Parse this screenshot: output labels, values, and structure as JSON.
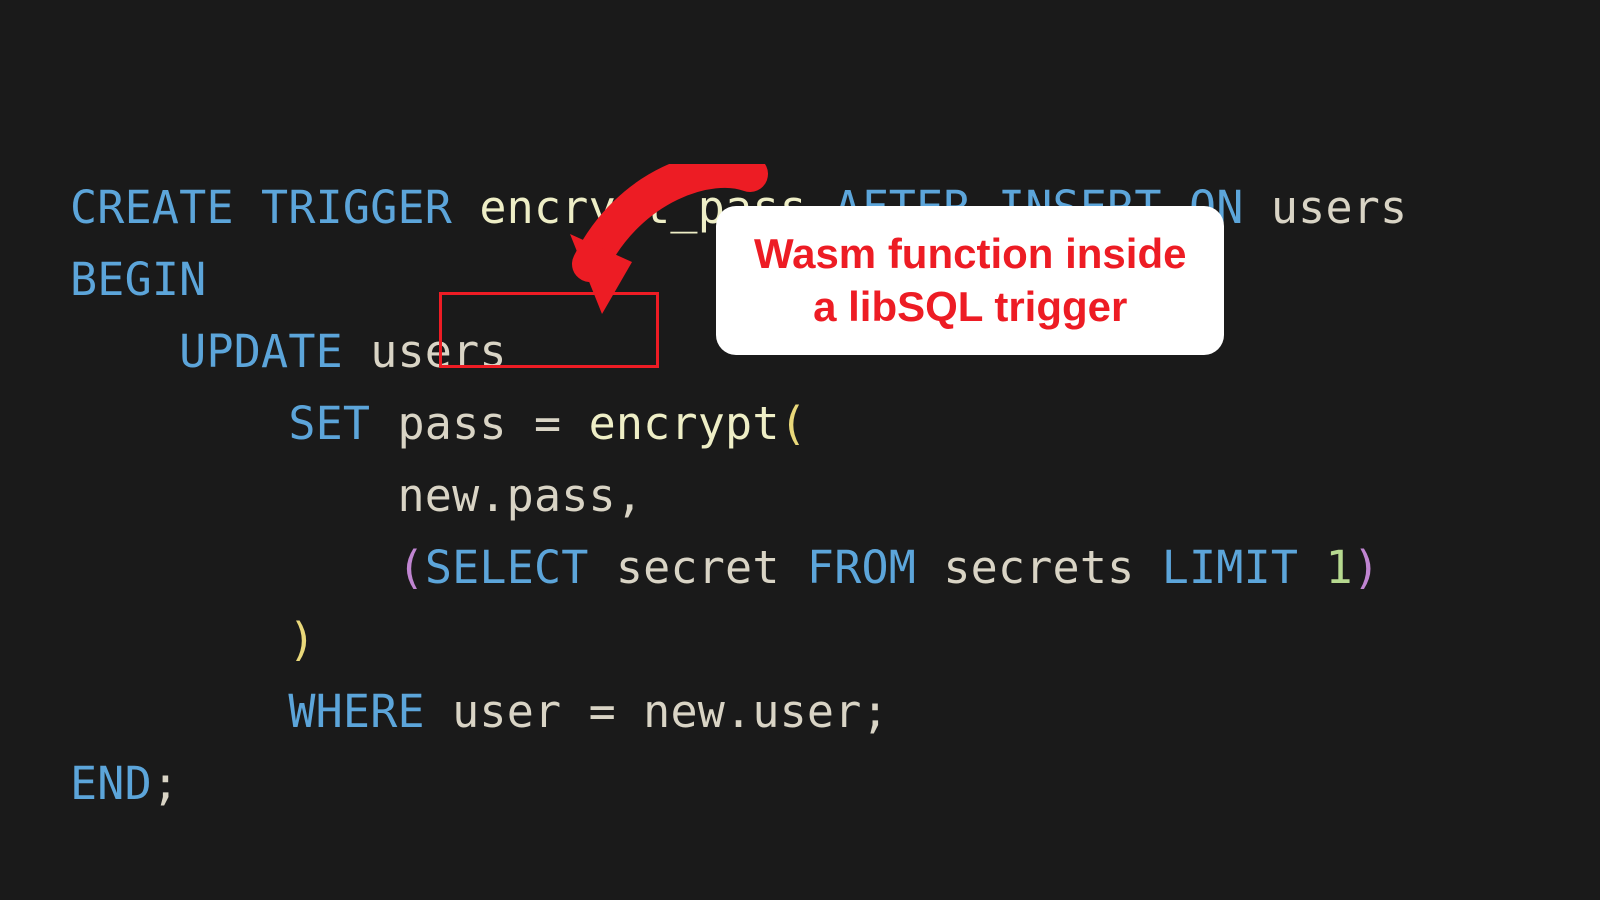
{
  "code": {
    "line1": {
      "kw_create_trigger": "CREATE TRIGGER ",
      "fn": "encrypt_pass ",
      "kw_after_insert_on": "AFTER INSERT ON ",
      "ident": "users"
    },
    "line2": {
      "kw_begin": "BEGIN"
    },
    "line3": {
      "indent": "    ",
      "kw_update": "UPDATE ",
      "ident": "users"
    },
    "line4": {
      "indent": "        ",
      "kw_set": "SET ",
      "ident": "pass ",
      "eq": "= ",
      "fn": "encrypt",
      "paren": "("
    },
    "line5": {
      "indent": "            ",
      "dotted": "new.pass",
      "comma": ","
    },
    "line6": {
      "indent": "            ",
      "open": "(",
      "kw_select": "SELECT ",
      "id1": "secret ",
      "kw_from": "FROM ",
      "id2": "secrets ",
      "kw_limit": "LIMIT ",
      "num": "1",
      "close": ")"
    },
    "line7": {
      "indent": "        ",
      "paren": ")"
    },
    "line8": {
      "indent": "        ",
      "kw_where": "WHERE ",
      "id1": "user ",
      "eq": "= ",
      "id2": "new.user",
      "semi": ";"
    },
    "line9": {
      "kw_end": "END",
      "semi": ";"
    }
  },
  "callout": {
    "text_line1": "Wasm function inside",
    "text_line2": "a libSQL trigger"
  },
  "colors": {
    "bg": "#1a1a1a",
    "keyword": "#5ca5da",
    "identifier": "#d9d4c5",
    "function": "#eeeec6",
    "paren_yellow": "#e9d87a",
    "paren_magenta": "#c085d1",
    "number": "#b6d98f",
    "accent_red": "#ed1c24",
    "callout_bg": "#ffffff"
  }
}
